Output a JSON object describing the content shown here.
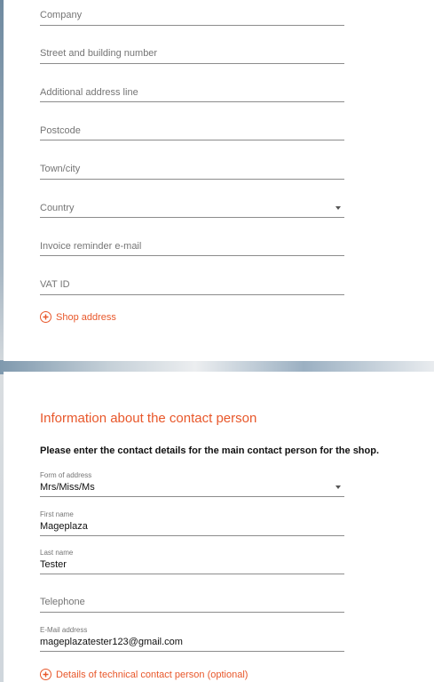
{
  "address_section": {
    "fields": {
      "company": {
        "placeholder": "Company"
      },
      "street": {
        "placeholder": "Street and building number"
      },
      "additional": {
        "placeholder": "Additional address line"
      },
      "postcode": {
        "placeholder": "Postcode"
      },
      "town": {
        "placeholder": "Town/city"
      },
      "country": {
        "placeholder": "Country"
      },
      "invoice_email": {
        "placeholder": "Invoice reminder e-mail"
      },
      "vat": {
        "placeholder": "VAT ID"
      }
    },
    "shop_address_label": "Shop address"
  },
  "contact_section": {
    "title": "Information about the contact person",
    "description": "Please enter the contact details for the main contact person for the shop.",
    "form_of_address": {
      "label": "Form of address",
      "value": "Mrs/Miss/Ms"
    },
    "first_name": {
      "label": "First name",
      "value": "Mageplaza"
    },
    "last_name": {
      "label": "Last name",
      "value": "Tester"
    },
    "telephone": {
      "placeholder": "Telephone"
    },
    "email": {
      "label": "E-Mail address",
      "value": "mageplazatester123@gmail.com"
    },
    "technical_contact_label": "Details of technical contact person (optional)"
  },
  "colors": {
    "accent": "#e8572a",
    "text": "#111111",
    "muted": "#757575"
  },
  "icons": [
    "plus-circle-icon",
    "dropdown-arrow-icon"
  ]
}
